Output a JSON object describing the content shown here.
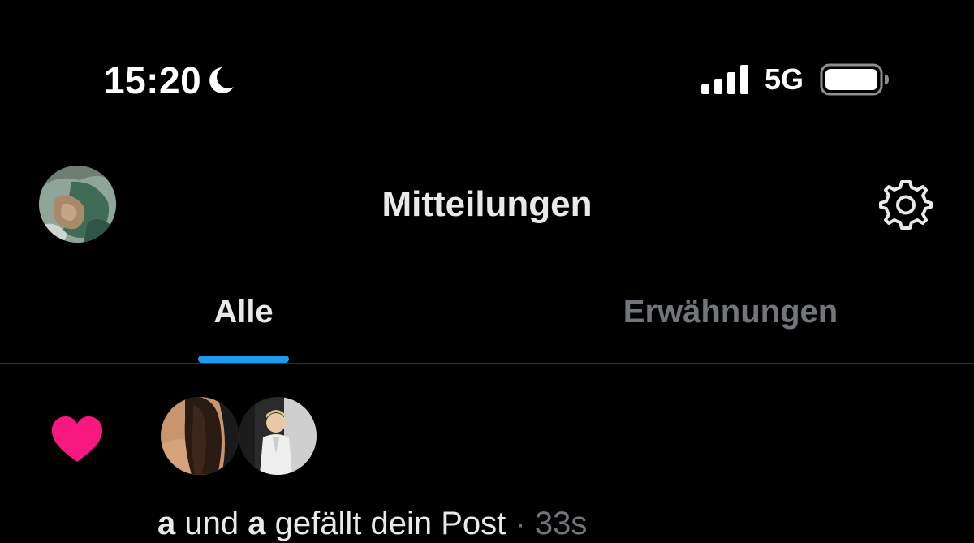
{
  "status_bar": {
    "time": "15:20",
    "network": "5G",
    "icons": [
      "moon-icon",
      "signal-icon",
      "battery-icon"
    ]
  },
  "header": {
    "title": "Mitteilungen",
    "icons": [
      "avatar",
      "gear-icon"
    ]
  },
  "tabs": [
    {
      "label": "Alle",
      "active": true
    },
    {
      "label": "Erwähnungen",
      "active": false
    }
  ],
  "notification": {
    "icon": "heart-icon",
    "user1": "a",
    "connector": "und",
    "user2": "a",
    "action": "gefällt dein Post",
    "separator": "·",
    "time": "33s"
  },
  "colors": {
    "background": "#000000",
    "text_primary": "#e7e9ea",
    "text_secondary": "#71767b",
    "accent": "#1d9bf0",
    "like": "#f91880",
    "divider": "#2f3336"
  }
}
